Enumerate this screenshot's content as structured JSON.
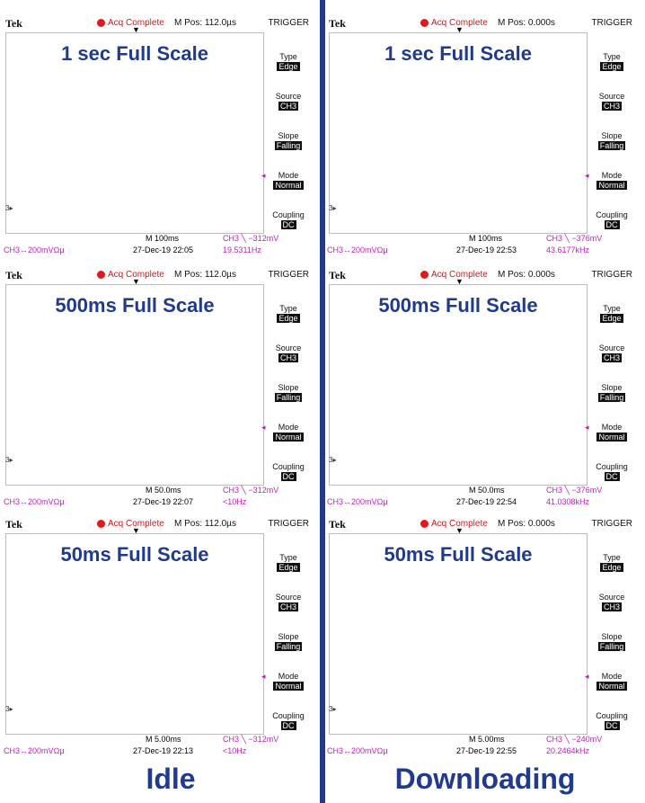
{
  "scopes": [
    {
      "brand": "Tek",
      "acq": "Acq Complete",
      "mpos": "M Pos: 112.0µs",
      "trigger": "TRIGGER",
      "title": "1 sec Full Scale",
      "menu": [
        {
          "k": "Type",
          "v": "Edge"
        },
        {
          "k": "Source",
          "v": "CH3"
        },
        {
          "k": "Slope",
          "v": "Falling"
        },
        {
          "k": "Mode",
          "v": "Normal"
        },
        {
          "k": "Coupling",
          "v": "DC"
        }
      ],
      "mscale": "M 100ms",
      "date": "27-Dec-19 22:05",
      "ch3level": "CH3 ╲ −312mV",
      "freq": "19.5311Hz",
      "ch3scale": "CH3↔200mVΩμ"
    },
    {
      "brand": "Tek",
      "acq": "Acq Complete",
      "mpos": "M Pos: 0.000s",
      "trigger": "TRIGGER",
      "title": "1 sec Full Scale",
      "menu": [
        {
          "k": "Type",
          "v": "Edge"
        },
        {
          "k": "Source",
          "v": "CH3"
        },
        {
          "k": "Slope",
          "v": "Falling"
        },
        {
          "k": "Mode",
          "v": "Normal"
        },
        {
          "k": "Coupling",
          "v": "DC"
        }
      ],
      "mscale": "M 100ms",
      "date": "27-Dec-19 22:53",
      "ch3level": "CH3 ╲ −376mV",
      "freq": "43.6177kHz",
      "ch3scale": "CH3↔200mVΩμ"
    },
    {
      "brand": "Tek",
      "acq": "Acq Complete",
      "mpos": "M Pos: 112.0µs",
      "trigger": "TRIGGER",
      "title": "500ms Full Scale",
      "menu": [
        {
          "k": "Type",
          "v": "Edge"
        },
        {
          "k": "Source",
          "v": "CH3"
        },
        {
          "k": "Slope",
          "v": "Falling"
        },
        {
          "k": "Mode",
          "v": "Normal"
        },
        {
          "k": "Coupling",
          "v": "DC"
        }
      ],
      "mscale": "M 50.0ms",
      "date": "27-Dec-19 22:07",
      "ch3level": "CH3 ╲ −312mV",
      "freq": "<10Hz",
      "ch3scale": "CH3↔200mVΩμ"
    },
    {
      "brand": "Tek",
      "acq": "Acq Complete",
      "mpos": "M Pos: 0.000s",
      "trigger": "TRIGGER",
      "title": "500ms Full Scale",
      "menu": [
        {
          "k": "Type",
          "v": "Edge"
        },
        {
          "k": "Source",
          "v": "CH3"
        },
        {
          "k": "Slope",
          "v": "Falling"
        },
        {
          "k": "Mode",
          "v": "Normal"
        },
        {
          "k": "Coupling",
          "v": "DC"
        }
      ],
      "mscale": "M 50.0ms",
      "date": "27-Dec-19 22:54",
      "ch3level": "CH3 ╲ −376mV",
      "freq": "41.0308kHz",
      "ch3scale": "CH3↔200mVΩμ"
    },
    {
      "brand": "Tek",
      "acq": "Acq Complete",
      "mpos": "M Pos: 112.0µs",
      "trigger": "TRIGGER",
      "title": "50ms Full Scale",
      "menu": [
        {
          "k": "Type",
          "v": "Edge"
        },
        {
          "k": "Source",
          "v": "CH3"
        },
        {
          "k": "Slope",
          "v": "Falling"
        },
        {
          "k": "Mode",
          "v": "Normal"
        },
        {
          "k": "Coupling",
          "v": "DC"
        }
      ],
      "mscale": "M 5.00ms",
      "date": "27-Dec-19 22:13",
      "ch3level": "CH3 ╲ −312mV",
      "freq": "<10Hz",
      "ch3scale": "CH3↔200mVΩμ"
    },
    {
      "brand": "Tek",
      "acq": "Acq Complete",
      "mpos": "M Pos: 0.000s",
      "trigger": "TRIGGER",
      "title": "50ms Full Scale",
      "menu": [
        {
          "k": "Type",
          "v": "Edge"
        },
        {
          "k": "Source",
          "v": "CH3"
        },
        {
          "k": "Slope",
          "v": "Falling"
        },
        {
          "k": "Mode",
          "v": "Normal"
        },
        {
          "k": "Coupling",
          "v": "DC"
        }
      ],
      "mscale": "M 5.00ms",
      "date": "27-Dec-19 22:55",
      "ch3level": "CH3 ╲ −240mV",
      "freq": "20.2464kHz",
      "ch3scale": "CH3↔200mVΩμ"
    }
  ],
  "labels": {
    "left": "Idle",
    "right": "Downloading"
  },
  "colors": {
    "trace": "#c020c0",
    "title": "#203a8c",
    "acq_dot": "#e0191d",
    "grid": "#bdbdbd"
  }
}
